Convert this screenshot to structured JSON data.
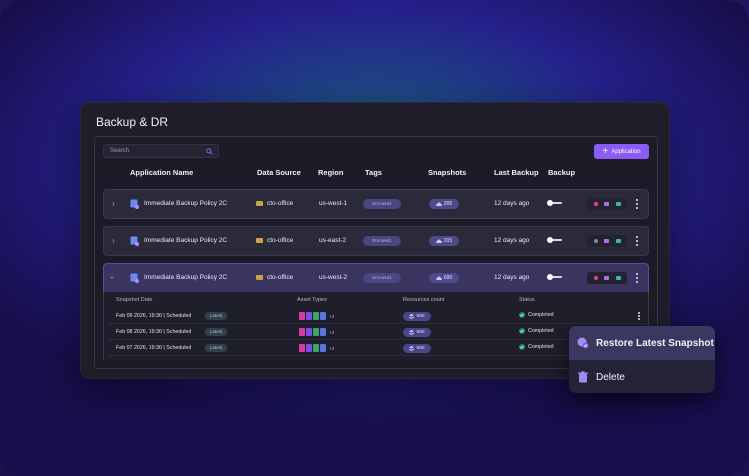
{
  "panel": {
    "title": "Backup & DR"
  },
  "search": {
    "placeholder": "Search"
  },
  "toolbar": {
    "add_label": "Application"
  },
  "table": {
    "headers": [
      "Application Name",
      "Data Source",
      "Region",
      "Tags",
      "Snapshots",
      "Last Backup",
      "Backup"
    ],
    "rows": [
      {
        "name": "Immediate Backup Policy 2C",
        "source": "cto-office",
        "region": "us-west-1",
        "tag": "Env:wed1",
        "snapshots": "205",
        "last_backup": "12 days ago",
        "expanded": false,
        "status_dot_color": "#e0457b"
      },
      {
        "name": "Immediate Backup Policy 2C",
        "source": "cto-office",
        "region": "us-east-2",
        "tag": "Env:wed1",
        "snapshots": "315",
        "last_backup": "12 days ago",
        "expanded": false,
        "status_dot_color": "#8a8a96"
      },
      {
        "name": "Immediate Backup Policy 2C",
        "source": "cto-office",
        "region": "us-west-2",
        "tag": "Env:wed1",
        "snapshots": "690",
        "last_backup": "12 days ago",
        "expanded": true,
        "status_dot_color": "#e0457b"
      }
    ]
  },
  "snapshots": {
    "headers": [
      "Snapshot Date",
      "Asset Types",
      "Resources count",
      "Status"
    ],
    "rows": [
      {
        "date": "Feb 09 2026, 19:30 | Scheduled",
        "badge": "Latest",
        "asset_more": "+3",
        "resources": "690",
        "status": "Completed"
      },
      {
        "date": "Feb 08 2026, 19:30 | Scheduled",
        "badge": "Latest",
        "asset_more": "+3",
        "resources": "690",
        "status": "Completed"
      },
      {
        "date": "Feb 07 2026, 19:30 | Scheduled",
        "badge": "Latest",
        "asset_more": "+3",
        "resources": "690",
        "status": "Completed"
      }
    ]
  },
  "context_menu": {
    "items": [
      {
        "label": "Restore Latest Snapshot",
        "icon": "restore-icon"
      },
      {
        "label": "Delete",
        "icon": "trash-icon"
      }
    ]
  },
  "colors": {
    "accent": "#8a5cf5",
    "success": "#1f8a6a",
    "pill": "#4f4a8a"
  }
}
